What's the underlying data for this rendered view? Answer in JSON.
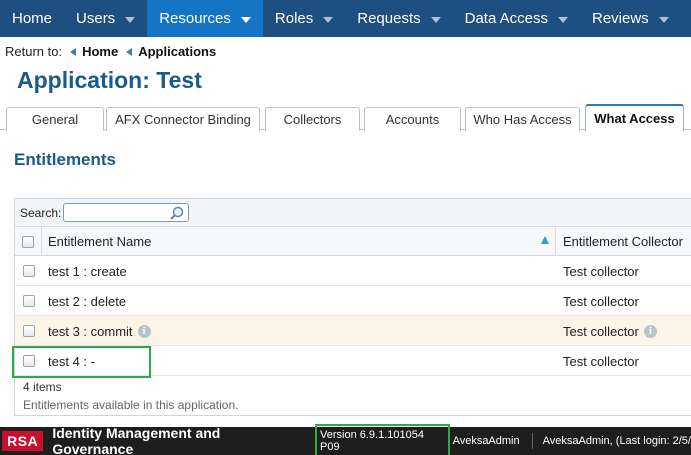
{
  "nav": {
    "items": [
      {
        "label": "Home",
        "has_caret": false
      },
      {
        "label": "Users",
        "has_caret": true
      },
      {
        "label": "Resources",
        "has_caret": true,
        "active": true
      },
      {
        "label": "Roles",
        "has_caret": true
      },
      {
        "label": "Requests",
        "has_caret": true
      },
      {
        "label": "Data Access",
        "has_caret": true
      },
      {
        "label": "Reviews",
        "has_caret": true
      }
    ]
  },
  "breadcrumb": {
    "prefix": "Return to:",
    "items": [
      "Home",
      "Applications"
    ]
  },
  "page_title": "Application: Test",
  "tabs": [
    {
      "label": "General"
    },
    {
      "label": "AFX Connector Binding"
    },
    {
      "label": "Collectors"
    },
    {
      "label": "Accounts"
    },
    {
      "label": "Who Has Access"
    },
    {
      "label": "What Access",
      "active": true
    }
  ],
  "section_title": "Entitlements",
  "grid": {
    "search_label": "Search:",
    "search_value": "",
    "columns": [
      "Entitlement Name",
      "Entitlement Collector"
    ],
    "rows": [
      {
        "name": "test 1 : create",
        "collector": "Test collector",
        "info": false
      },
      {
        "name": "test 2 : delete",
        "collector": "Test collector",
        "info": false
      },
      {
        "name": "test 3 : commit",
        "collector": "Test collector",
        "info": true
      },
      {
        "name": "test 4 : -",
        "collector": "Test collector",
        "info": false
      }
    ],
    "count_text": "4 items",
    "description": "Entitlements available in this application."
  },
  "footer": {
    "logo_text": "RSA",
    "product": "Identity Management and Governance",
    "version": "Version 6.9.1.101054 P09",
    "user": "AveksaAdmin",
    "login": "AveksaAdmin, (Last login: 2/5/"
  },
  "colors": {
    "nav_bg": "#1d4f80",
    "nav_active": "#1574c4",
    "title": "#1a5a8e",
    "highlight_border": "#2eaa4a",
    "logo_red": "#c8102e"
  }
}
